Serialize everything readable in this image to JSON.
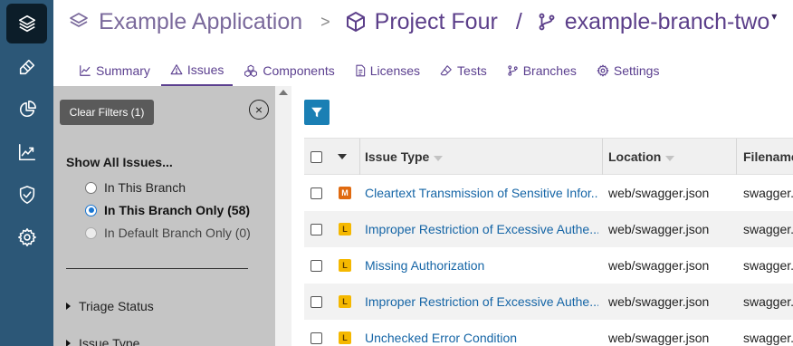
{
  "header": {
    "app_name": "Example Application",
    "separator": ">",
    "project_name": "Project Four",
    "branch_separator": "/",
    "branch_name": "example-branch-two",
    "branch_caret": "▾"
  },
  "tabs": [
    {
      "label": "Summary",
      "icon": "chart-line-icon",
      "active": false
    },
    {
      "label": "Issues",
      "icon": "warning-triangle-icon",
      "active": true
    },
    {
      "label": "Components",
      "icon": "cubes-icon",
      "active": false
    },
    {
      "label": "Licenses",
      "icon": "file-text-icon",
      "active": false
    },
    {
      "label": "Tests",
      "icon": "eraser-icon",
      "active": false
    },
    {
      "label": "Branches",
      "icon": "git-branch-icon",
      "active": false
    },
    {
      "label": "Settings",
      "icon": "gear-icon",
      "active": false
    }
  ],
  "sidebar": {
    "logo_icon": "layers-icon",
    "nav": [
      "paint-brush-icon",
      "pie-chart-icon",
      "trend-chart-icon",
      "shield-check-icon",
      "gear-icon"
    ]
  },
  "filters": {
    "clear_label": "Clear Filters (1)",
    "close_symbol": "×",
    "show_all_label": "Show All Issues...",
    "options": [
      {
        "label": "In This Branch",
        "checked": false,
        "disabled": false
      },
      {
        "label": "In This Branch Only (58)",
        "checked": true,
        "disabled": false
      },
      {
        "label": "In Default Branch Only (0)",
        "checked": false,
        "disabled": true
      }
    ],
    "sections": [
      "Triage Status",
      "Issue Type"
    ]
  },
  "table": {
    "columns": [
      "Issue Type",
      "Location",
      "Filename"
    ],
    "rows": [
      {
        "severity": "M",
        "severity_color": "#e06a10",
        "issue_type": "Cleartext Transmission of Sensitive Infor...",
        "location": "web/swagger.json",
        "filename": "swagger.json"
      },
      {
        "severity": "L",
        "severity_color": "#f5b800",
        "issue_type": "Improper Restriction of Excessive Authe...",
        "location": "web/swagger.json",
        "filename": "swagger.json"
      },
      {
        "severity": "L",
        "severity_color": "#f5b800",
        "issue_type": "Missing Authorization",
        "location": "web/swagger.json",
        "filename": "swagger.json"
      },
      {
        "severity": "L",
        "severity_color": "#f5b800",
        "issue_type": "Improper Restriction of Excessive Authe...",
        "location": "web/swagger.json",
        "filename": "swagger.json"
      },
      {
        "severity": "L",
        "severity_color": "#f5b800",
        "issue_type": "Unchecked Error Condition",
        "location": "web/swagger.json",
        "filename": "swagger.json"
      }
    ]
  },
  "colors": {
    "rail": "#2c5777",
    "accent": "#5b3f8f",
    "link": "#1565a6",
    "filter_button": "#1a7fb4",
    "severity_medium": "#e06a10",
    "severity_low": "#f5b800"
  }
}
